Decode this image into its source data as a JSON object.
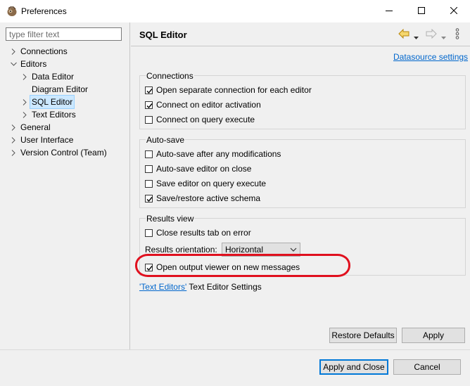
{
  "window": {
    "title": "Preferences",
    "minimize_icon": "minimize-icon",
    "maximize_icon": "maximize-icon",
    "close_icon": "close-icon"
  },
  "sidebar": {
    "filter_placeholder": "type filter text",
    "items": [
      {
        "label": "Connections",
        "expander": "collapsed"
      },
      {
        "label": "Editors",
        "expander": "expanded"
      },
      {
        "label": "Data Editor",
        "expander": "collapsed"
      },
      {
        "label": "Diagram Editor",
        "expander": "none"
      },
      {
        "label": "SQL Editor",
        "expander": "collapsed",
        "selected": true
      },
      {
        "label": "Text Editors",
        "expander": "collapsed"
      },
      {
        "label": "General",
        "expander": "collapsed"
      },
      {
        "label": "User Interface",
        "expander": "collapsed"
      },
      {
        "label": "Version Control (Team)",
        "expander": "collapsed"
      }
    ]
  },
  "header": {
    "title": "SQL Editor",
    "back_icon": "back-arrow-icon",
    "forward_icon": "forward-arrow-icon",
    "menu_icon": "vertical-dots-icon"
  },
  "datasource_link": "Datasource settings",
  "groups": {
    "connections": {
      "title": "Connections",
      "options": [
        {
          "label": "Open separate connection for each editor",
          "checked": true
        },
        {
          "label": "Connect on editor activation",
          "checked": true
        },
        {
          "label": "Connect on query execute",
          "checked": false
        }
      ]
    },
    "autosave": {
      "title": "Auto-save",
      "options": [
        {
          "label": "Auto-save after any modifications",
          "checked": false
        },
        {
          "label": "Auto-save editor on close",
          "checked": false
        },
        {
          "label": "Save editor on query execute",
          "checked": false
        },
        {
          "label": "Save/restore active schema",
          "checked": true
        }
      ]
    },
    "results": {
      "title": "Results view",
      "close_on_error": {
        "label": "Close results tab on error",
        "checked": false
      },
      "orientation_label": "Results orientation:",
      "orientation_value": "Horizontal",
      "output_viewer": {
        "label": "Open output viewer on new messages",
        "checked": true
      }
    }
  },
  "text_editors": {
    "link": "'Text Editors'",
    "suffix": " Text Editor Settings"
  },
  "buttons": {
    "restore_defaults": "Restore Defaults",
    "apply": "Apply",
    "apply_and_close": "Apply and Close",
    "cancel": "Cancel"
  },
  "colors": {
    "highlight_ellipse": "#e0101e",
    "link": "#0066cc",
    "selection": "#cce8ff",
    "default_button_border": "#0078d7"
  }
}
